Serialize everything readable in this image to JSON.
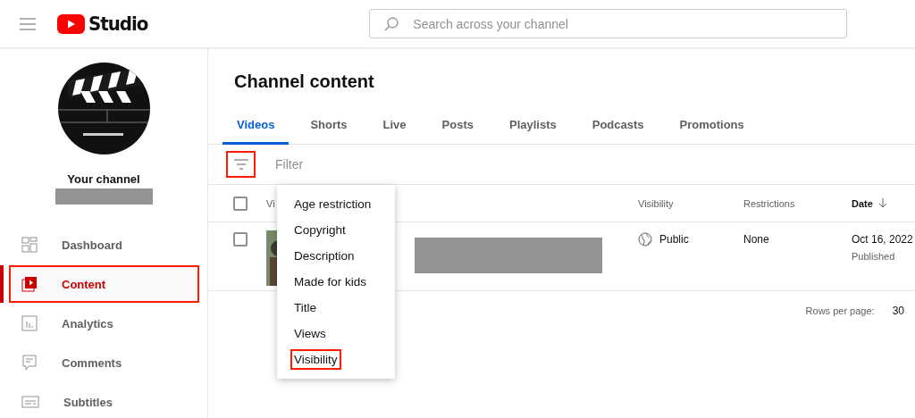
{
  "header": {
    "logo_text": "Studio",
    "search": {
      "placeholder": "Search across your channel"
    }
  },
  "sidebar": {
    "channel_label": "Your channel",
    "channel_name_redacted": true,
    "items": [
      {
        "label": "Dashboard",
        "kind": "dashboard",
        "selected": false,
        "highlighted": false
      },
      {
        "label": "Content",
        "kind": "content",
        "selected": true,
        "highlighted": true
      },
      {
        "label": "Analytics",
        "kind": "analytics",
        "selected": false,
        "highlighted": false
      },
      {
        "label": "Comments",
        "kind": "comments",
        "selected": false,
        "highlighted": false
      },
      {
        "label": "Subtitles",
        "kind": "subtitles",
        "selected": false,
        "highlighted": false
      }
    ]
  },
  "page_title": "Channel content",
  "tabs": [
    {
      "label": "Videos",
      "selected": true
    },
    {
      "label": "Shorts",
      "selected": false
    },
    {
      "label": "Live",
      "selected": false
    },
    {
      "label": "Posts",
      "selected": false
    },
    {
      "label": "Playlists",
      "selected": false
    },
    {
      "label": "Podcasts",
      "selected": false
    },
    {
      "label": "Promotions",
      "selected": false
    }
  ],
  "filter": {
    "placeholder": "Filter",
    "button_highlighted": true
  },
  "table": {
    "select_all_checked": false,
    "columns": [
      {
        "label": "Vi",
        "sorted": false
      },
      {
        "label": "Visibility",
        "sorted": false
      },
      {
        "label": "Restrictions",
        "sorted": false
      },
      {
        "label": "Date",
        "sorted": true
      }
    ],
    "rows": [
      {
        "checked": false,
        "video_redacted": true,
        "visibility": "Public",
        "restrictions": "None",
        "date": "Oct 16, 2022",
        "status": "Published"
      }
    ],
    "rows_per_page_label": "Rows per page:",
    "rows_per_page": "30"
  },
  "filter_menu": [
    {
      "label": "Age restriction",
      "highlighted": false
    },
    {
      "label": "Copyright",
      "highlighted": false
    },
    {
      "label": "Description",
      "highlighted": false
    },
    {
      "label": "Made for kids",
      "highlighted": false
    },
    {
      "label": "Title",
      "highlighted": false
    },
    {
      "label": "Views",
      "highlighted": false
    },
    {
      "label": "Visibility",
      "highlighted": true
    }
  ]
}
